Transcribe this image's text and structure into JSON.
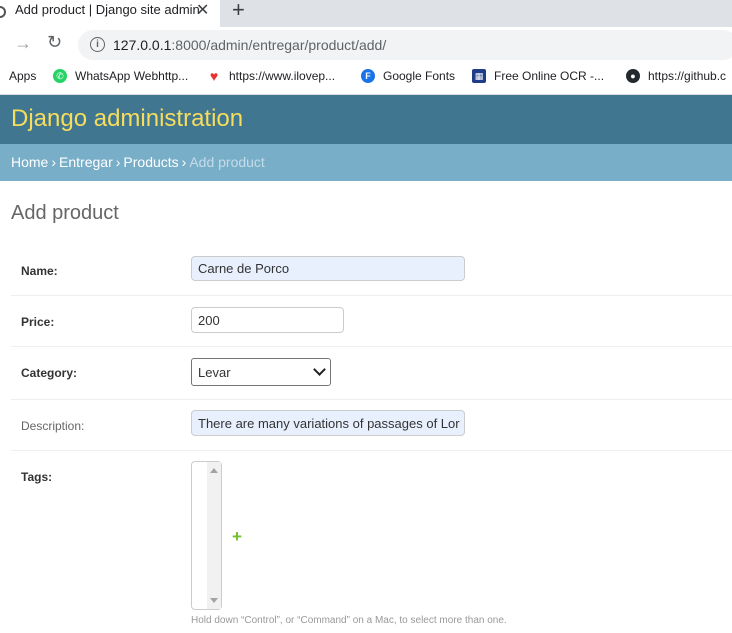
{
  "browser": {
    "tab_title": "Add product | Django site admin",
    "close_glyph": "✕",
    "newtab_glyph": "+",
    "url_host": "127.0.0.1",
    "url_rest": ":8000/admin/entregar/product/add/",
    "bookmarks": [
      {
        "label": "Apps",
        "icon": "apps-grid-icon"
      },
      {
        "label": "WhatsApp Webhttp...",
        "icon": "whatsapp-icon",
        "color": "#25d366"
      },
      {
        "label": "https://www.ilovep...",
        "icon": "heart-icon",
        "color": "#e5322d"
      },
      {
        "label": "Google Fonts",
        "icon": "google-fonts-icon",
        "color": "#1a73e8"
      },
      {
        "label": "Free Online OCR -...",
        "icon": "ocr-icon",
        "color": "#1f3c88"
      },
      {
        "label": "https://github.c",
        "icon": "github-icon",
        "color": "#24292e"
      }
    ]
  },
  "admin": {
    "branding": "Django administration",
    "breadcrumbs": {
      "home": "Home",
      "app": "Entregar",
      "model": "Products",
      "current": "Add product",
      "sep": "›"
    },
    "title": "Add product",
    "fields": {
      "name": {
        "label": "Name:",
        "value": "Carne de Porco"
      },
      "price": {
        "label": "Price:",
        "value": "200"
      },
      "category": {
        "label": "Category:",
        "value": "Levar"
      },
      "description": {
        "label": "Description:",
        "value": "There are many variations of passages of Lor"
      },
      "tags": {
        "label": "Tags:",
        "add_glyph": "+",
        "help": "Hold down “Control”, or “Command” on a Mac, to select more than one."
      }
    }
  },
  "colors": {
    "header": "#417690",
    "breadcrumbs": "#79aec8",
    "branding": "#f5dd5d",
    "add": "#70bf2b"
  }
}
